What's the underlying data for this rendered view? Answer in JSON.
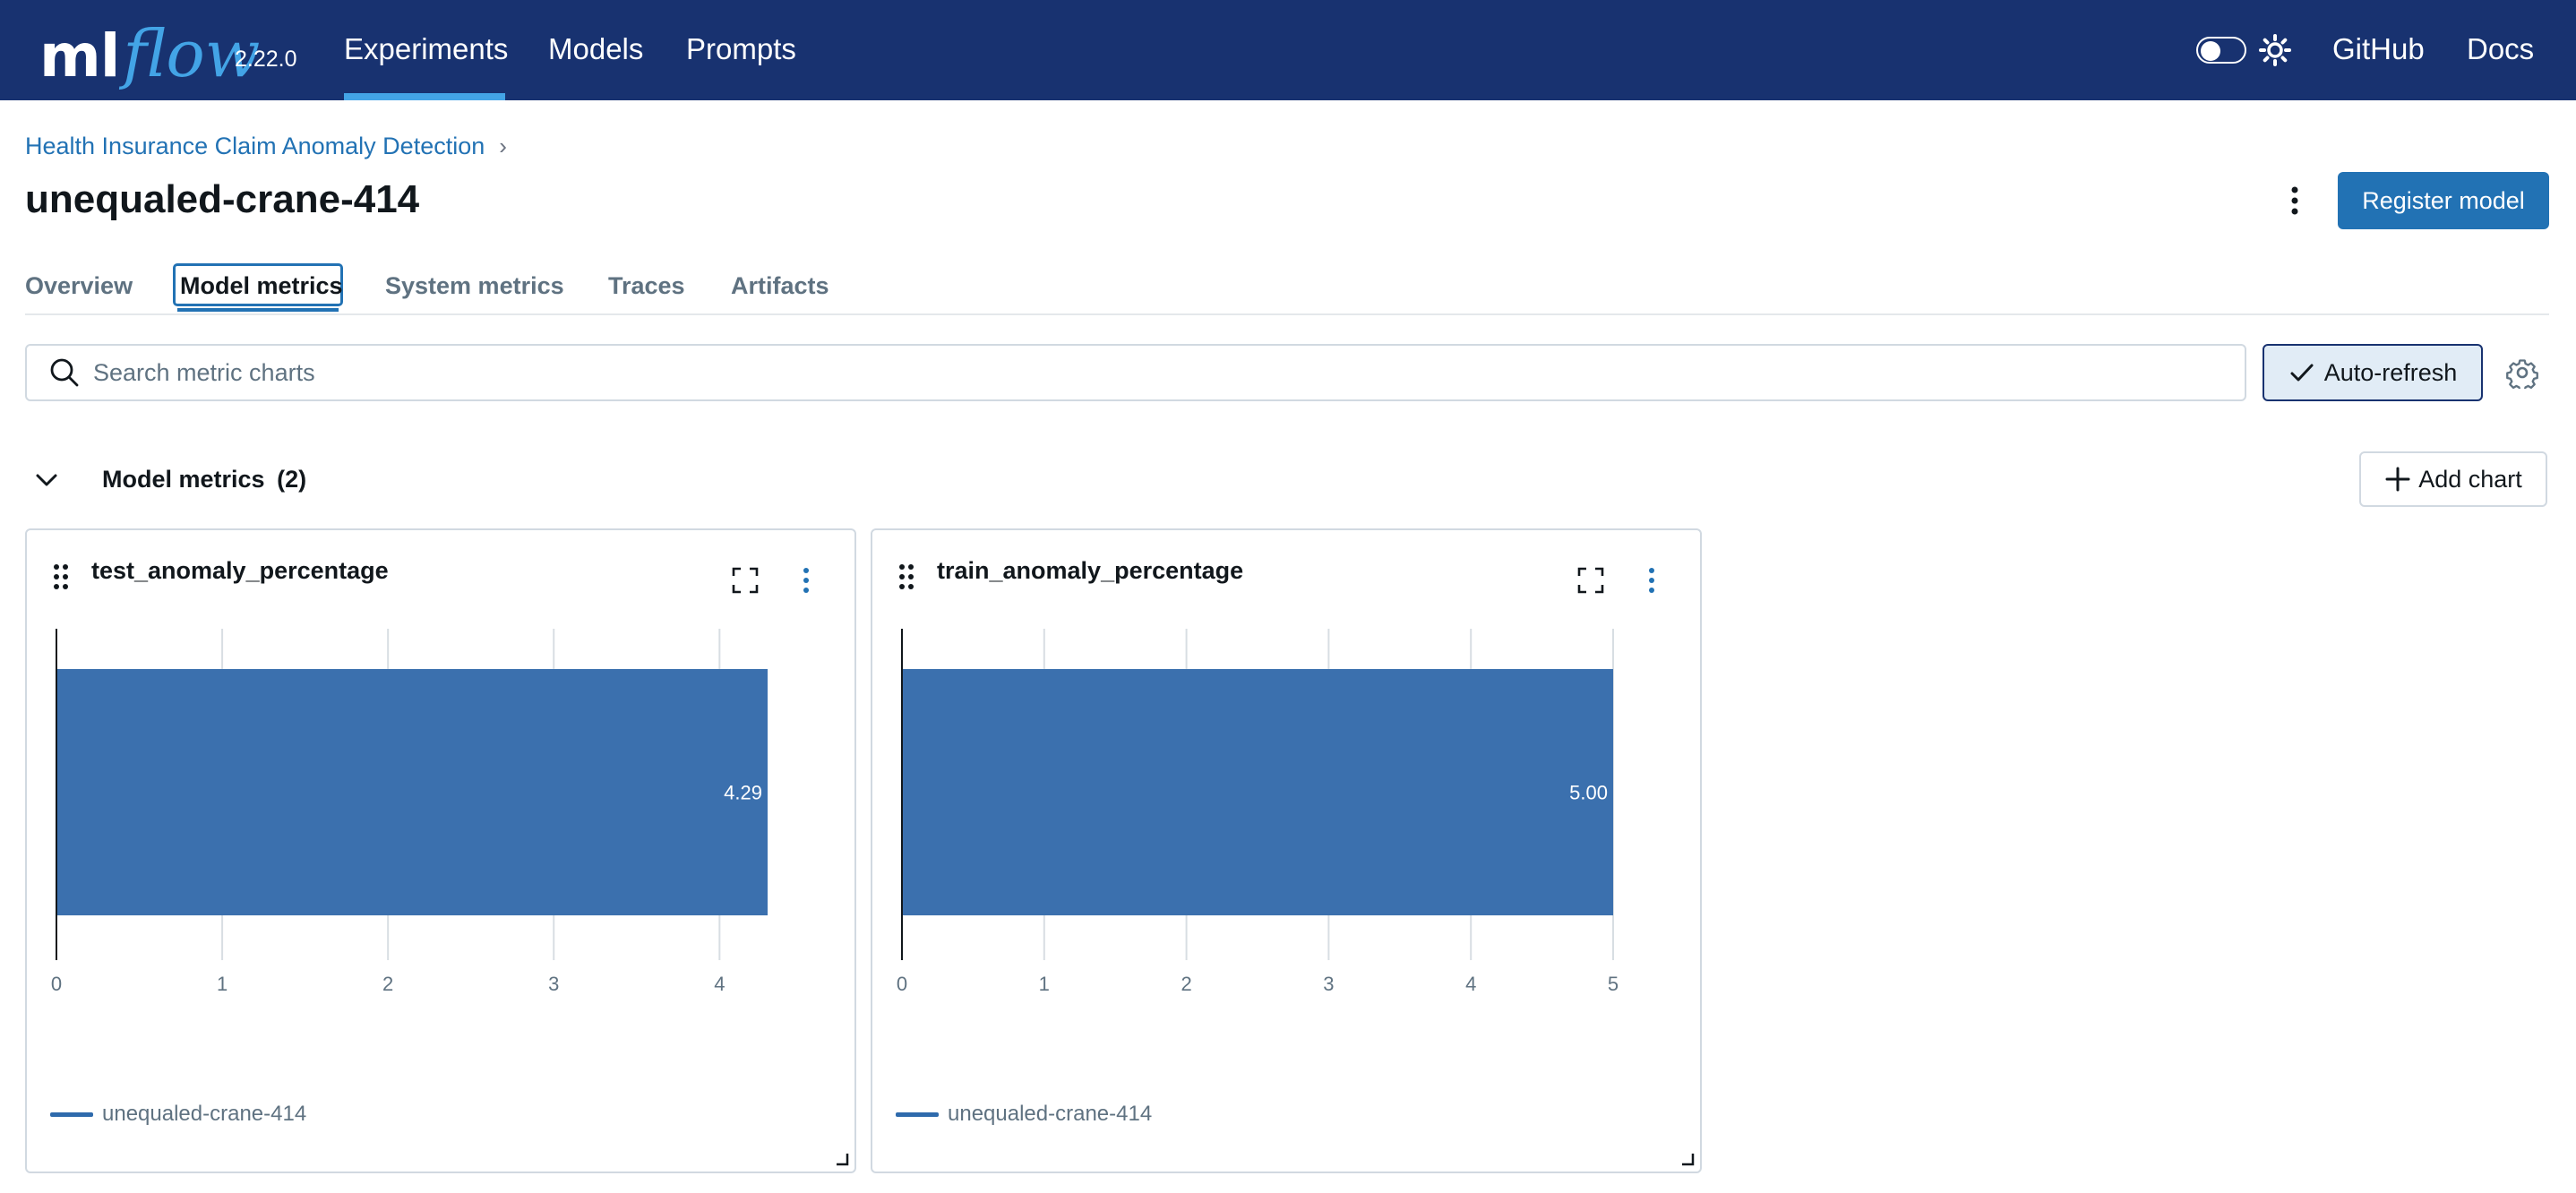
{
  "nav": {
    "logo_ml": "ml",
    "logo_flow": "flow",
    "version": "2.22.0",
    "links": [
      "Experiments",
      "Models",
      "Prompts"
    ],
    "github": "GitHub",
    "docs": "Docs"
  },
  "header": {
    "breadcrumb": "Health Insurance Claim Anomaly Detection",
    "title": "unequaled-crane-414",
    "register_label": "Register model"
  },
  "tabs": [
    "Overview",
    "Model metrics",
    "System metrics",
    "Traces",
    "Artifacts"
  ],
  "active_tab": "Model metrics",
  "search": {
    "placeholder": "Search metric charts",
    "value": ""
  },
  "autorefresh_label": "Auto-refresh",
  "section": {
    "title": "Model metrics",
    "count": "(2)",
    "add_chart_label": "Add chart"
  },
  "colors": {
    "nav_bg": "#183270",
    "accent": "#43a4e6",
    "primary": "#2272b4",
    "bar": "#3b70ae"
  },
  "chart_data": [
    {
      "type": "bar",
      "orientation": "horizontal",
      "title": "test_anomaly_percentage",
      "categories": [
        "unequaled-crane-414"
      ],
      "values": [
        4.29
      ],
      "value_labels": [
        "4.29"
      ],
      "xlim": [
        0,
        4.29
      ],
      "xticks": [
        0,
        1,
        2,
        3,
        4
      ],
      "grid": true,
      "legend": "bottom-left"
    },
    {
      "type": "bar",
      "orientation": "horizontal",
      "title": "train_anomaly_percentage",
      "categories": [
        "unequaled-crane-414"
      ],
      "values": [
        5.0
      ],
      "value_labels": [
        "5.00"
      ],
      "xlim": [
        0,
        5
      ],
      "xticks": [
        0,
        1,
        2,
        3,
        4,
        5
      ],
      "grid": true,
      "legend": "bottom-left"
    }
  ]
}
